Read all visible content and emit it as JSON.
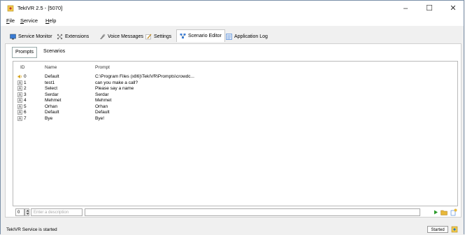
{
  "window": {
    "title": "TekIVR 2.5 - [5070]"
  },
  "menu": [
    {
      "underline": "F",
      "rest": "ile"
    },
    {
      "underline": "S",
      "rest": "ervice"
    },
    {
      "underline": "H",
      "rest": "elp"
    }
  ],
  "tabs": [
    {
      "label": "Service Monitor",
      "icon": "monitor-icon"
    },
    {
      "label": "Extensions",
      "icon": "extensions-icon"
    },
    {
      "label": "Voice Messages",
      "icon": "voice-messages-icon"
    },
    {
      "label": "Settings",
      "icon": "settings-icon"
    },
    {
      "label": "Scenario Editor",
      "icon": "scenario-editor-icon"
    },
    {
      "label": "Application Log",
      "icon": "application-log-icon"
    }
  ],
  "subtabs": [
    {
      "label": "Prompts"
    },
    {
      "label": "Scenarios"
    }
  ],
  "list": {
    "headers": {
      "id": "ID",
      "name": "Name",
      "prompt": "Prompt"
    },
    "rows": [
      {
        "id": "0",
        "name": "Default",
        "prompt": "C:\\Program Files (x86)\\TekIVR\\Prompts\\crowdc...",
        "icon": "speaker-icon"
      },
      {
        "id": "1",
        "name": "test1",
        "prompt": "can you make a call?",
        "icon": "text-prompt-icon"
      },
      {
        "id": "2",
        "name": "Select",
        "prompt": "Please say a name",
        "icon": "text-prompt-icon"
      },
      {
        "id": "3",
        "name": "Serdar",
        "prompt": "Serdar",
        "icon": "text-prompt-icon"
      },
      {
        "id": "4",
        "name": "Mehmet",
        "prompt": "Mehmet",
        "icon": "text-prompt-icon"
      },
      {
        "id": "5",
        "name": "Orhan",
        "prompt": "Orhan",
        "icon": "text-prompt-icon"
      },
      {
        "id": "6",
        "name": "Default",
        "prompt": "Default",
        "icon": "text-prompt-icon"
      },
      {
        "id": "7",
        "name": "Bye",
        "prompt": "Bye!",
        "icon": "text-prompt-icon"
      }
    ]
  },
  "editor": {
    "id_value": "0",
    "description_placeholder": "Enter a description",
    "prompt_value": ""
  },
  "status": {
    "text": "TekIVR Service is started",
    "badge": "Started"
  },
  "colors": {
    "accent": "#1e78c8",
    "play_green": "#2a9a2a",
    "folder_yellow": "#e8b83a"
  }
}
